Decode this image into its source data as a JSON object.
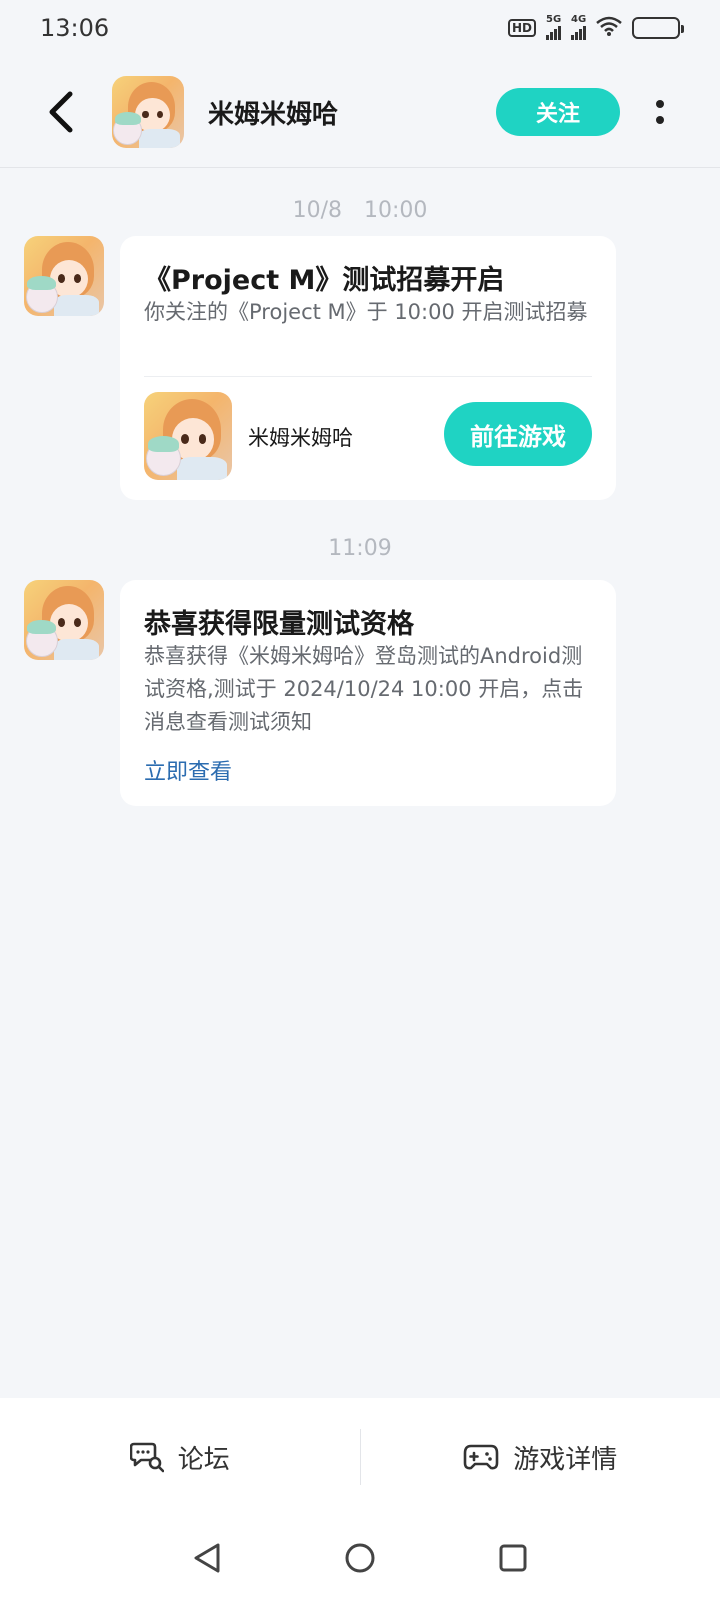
{
  "status_bar": {
    "time": "13:06",
    "hd_badge": "HD",
    "net1": "5G",
    "net2": "4G",
    "battery_level": 0.4,
    "icons": [
      "hd-icon",
      "signal-5g-icon",
      "signal-4g-icon",
      "wifi-icon",
      "battery-icon"
    ]
  },
  "header": {
    "title": "米姆米姆哈",
    "follow_label": "关注",
    "icons": [
      "back-arrow-icon",
      "more-vertical-icon"
    ]
  },
  "messages": [
    {
      "time": "10/8　10:00",
      "title": "《Project M》测试招募开启",
      "desc": "你关注的《Project M》于 10:00 开启测试招募",
      "game_name": "米姆米姆哈",
      "button_label": "前往游戏"
    },
    {
      "time": "11:09",
      "title": "恭喜获得限量测试资格",
      "desc": "恭喜获得《米姆米姆哈》登岛测试的Android测试资格,测试于 2024/10/24 10:00 开启，点击消息查看测试须知",
      "link_label": "立即查看"
    }
  ],
  "bottom_bar": {
    "forum_label": "论坛",
    "details_label": "游戏详情"
  },
  "colors": {
    "accent": "#1fd3c3",
    "link": "#2b6cb0",
    "background": "#f4f6f9"
  }
}
